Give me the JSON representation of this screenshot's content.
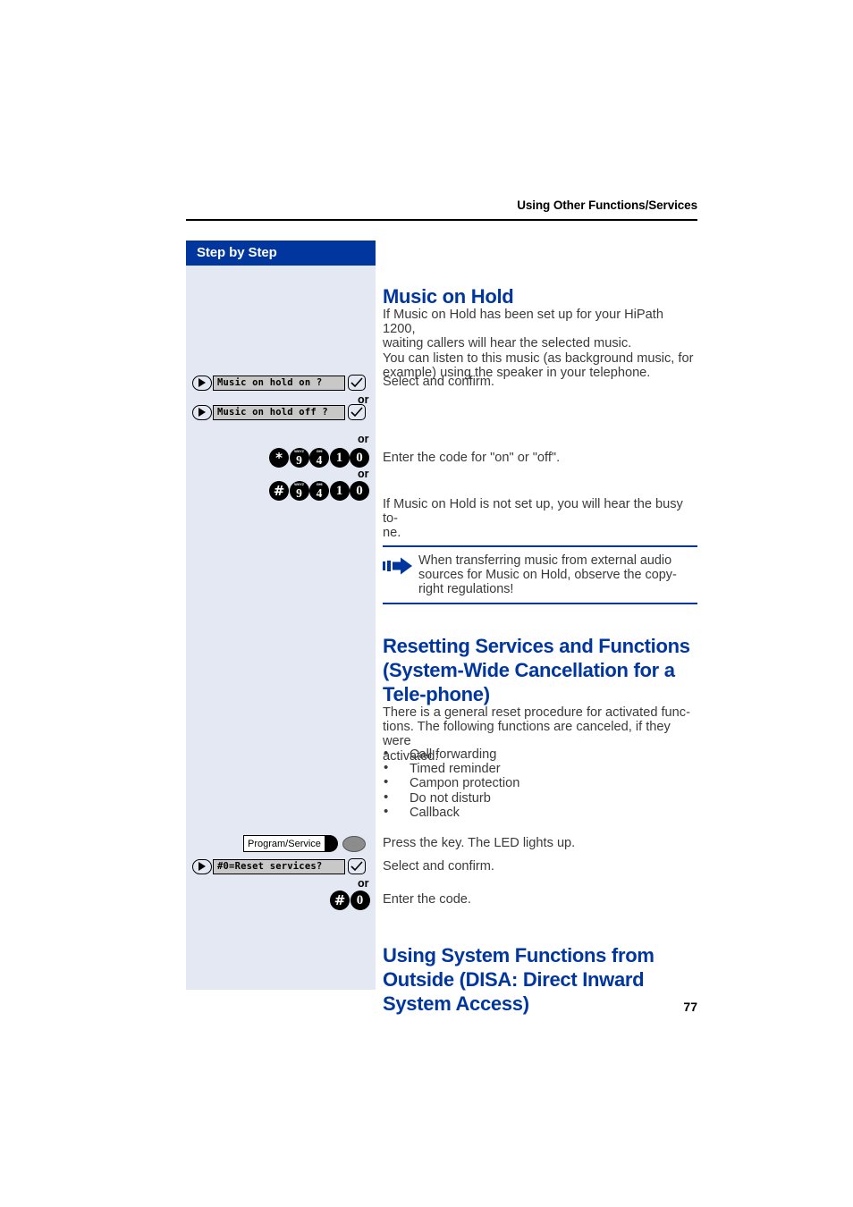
{
  "header": {
    "running_head": "Using Other Functions/Services"
  },
  "sidebar": {
    "title": "Step by Step",
    "or_labels": [
      "or",
      "or",
      "or"
    ],
    "rows": [
      {
        "type": "menu",
        "nav_icon": "navigate-key-icon",
        "lcd_text": "Music on hold on ?",
        "confirm_icon": "confirm-check-icon"
      },
      {
        "type": "menu",
        "nav_icon": "navigate-key-icon",
        "lcd_text": "Music on hold off ?",
        "confirm_icon": "confirm-check-icon"
      },
      {
        "type": "keypad",
        "keys": [
          {
            "glyph": "*",
            "letters": ""
          },
          {
            "glyph": "9",
            "letters": "WXYZ"
          },
          {
            "glyph": "4",
            "letters": "GHI"
          },
          {
            "glyph": "1",
            "letters": ""
          },
          {
            "glyph": "0",
            "letters": ""
          }
        ]
      },
      {
        "type": "keypad",
        "keys": [
          {
            "glyph": "#",
            "letters": ""
          },
          {
            "glyph": "9",
            "letters": "WXYZ"
          },
          {
            "glyph": "4",
            "letters": "GHI"
          },
          {
            "glyph": "1",
            "letters": ""
          },
          {
            "glyph": "0",
            "letters": ""
          }
        ]
      },
      {
        "type": "function-key",
        "label": "Program/Service",
        "led": "led-indicator"
      },
      {
        "type": "menu",
        "nav_icon": "navigate-key-icon",
        "lcd_text": "#0=Reset services?",
        "confirm_icon": "confirm-check-icon"
      },
      {
        "type": "keypad",
        "keys": [
          {
            "glyph": "#",
            "letters": ""
          },
          {
            "glyph": "0",
            "letters": ""
          }
        ]
      }
    ]
  },
  "main": {
    "heading_1": "Music on Hold",
    "intro_paragraph": "If Music on Hold has been set up for your HiPath 1200,\nwaiting callers will hear the selected music.\nYou can listen to this music (as background music, for\nexample) using the speaker in your telephone.",
    "step_select_confirm_1": "Select and confirm.",
    "step_enter_code_onoff": "Enter the code for \"on\" or \"off\".",
    "note_not_set_up": "If Music on Hold is not set up, you will hear the busy to-\nne.",
    "note_box": {
      "icon": "note-arrow-icon",
      "text": "When transferring music from external audio\nsources for Music on Hold, observe the copy-\nright regulations!"
    },
    "heading_2": "Resetting Services and Functions (System-Wide Cancellation for a Tele-phone)",
    "reset_paragraph": "There is a general reset procedure for activated func-\ntions. The following functions are canceled, if they were\nactivated:",
    "reset_bullets": [
      "Call forwarding",
      "Timed reminder",
      "Campon protection",
      "Do not disturb",
      "Callback"
    ],
    "step_press_key": "Press the key. The LED lights up.",
    "step_select_confirm_2": "Select and confirm.",
    "step_enter_code": "Enter the code.",
    "heading_3": "Using System Functions from Outside (DISA: Direct Inward System Access)"
  },
  "footer": {
    "page_number": "77"
  },
  "colors": {
    "accent_blue": "#00369e",
    "sidebar_bg": "#e3e8f3",
    "lcd_grey": "#c8c8c8",
    "body_text": "#3a3a3a"
  }
}
